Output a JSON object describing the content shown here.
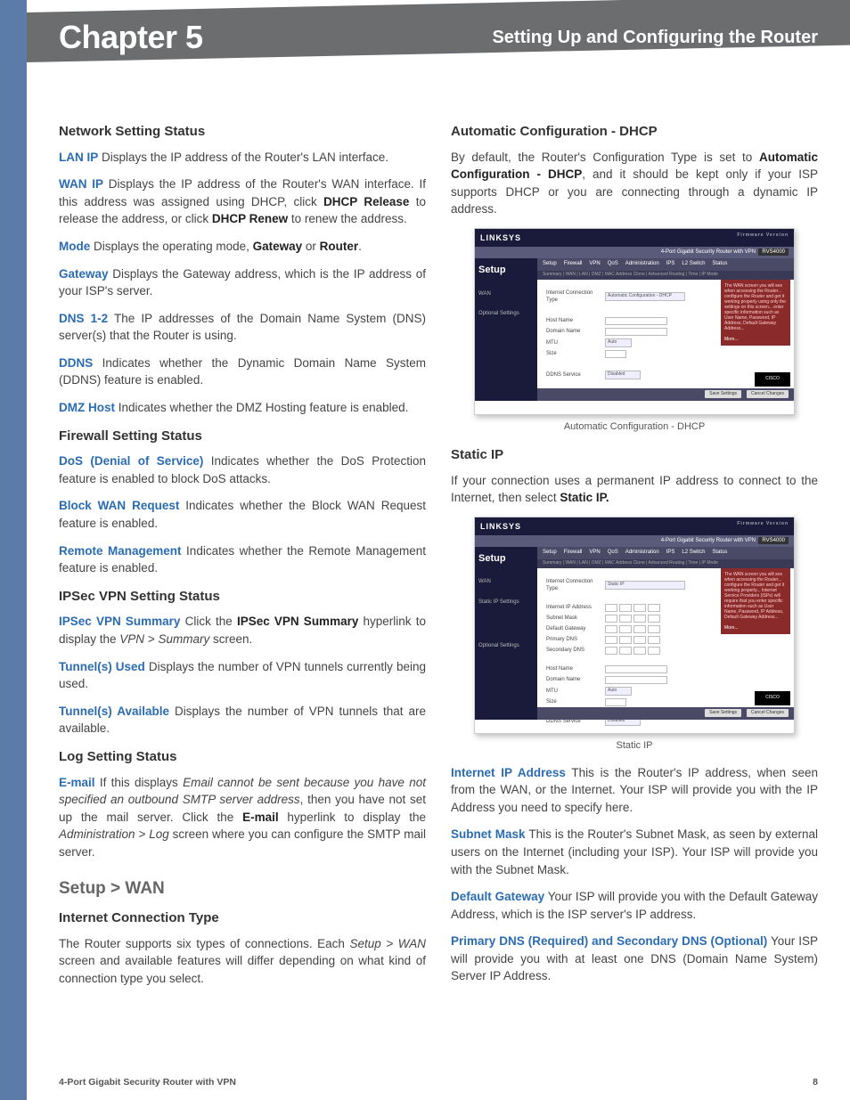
{
  "header": {
    "chapter": "Chapter 5",
    "section": "Setting Up and Configuring the Router"
  },
  "left": {
    "h_network": "Network Setting Status",
    "lan_ip_t": "LAN IP",
    "lan_ip": " Displays the IP address of the Router's LAN interface.",
    "wan_ip_t": "WAN IP",
    "wan_ip_a": " Displays the IP address of the Router's WAN interface. If this address was assigned using DHCP, click ",
    "wan_ip_b1": "DHCP Release",
    "wan_ip_c": " to release the address, or click ",
    "wan_ip_b2": "DHCP  Renew",
    "wan_ip_d": " to renew the address.",
    "mode_t": "Mode",
    "mode_a": "  Displays the operating mode, ",
    "mode_b1": "Gateway",
    "mode_c": " or ",
    "mode_b2": "Router",
    "mode_d": ".",
    "gw_t": "Gateway",
    "gw": "  Displays the Gateway address, which is the IP address of your ISP's server.",
    "dns_t": "DNS 1-2",
    "dns": "  The IP addresses of the Domain Name System (DNS) server(s) that the Router is using.",
    "ddns_t": "DDNS",
    "ddns": " Indicates whether the Dynamic Domain Name System (DDNS) feature is enabled.",
    "dmz_t": "DMZ Host",
    "dmz": "  Indicates whether the DMZ Hosting feature is enabled.",
    "h_firewall": "Firewall Setting Status",
    "dos_t": "DoS (Denial of Service)",
    "dos": " Indicates whether the DoS Protection feature is enabled to block DoS attacks.",
    "bwr_t": "Block WAN Request",
    "bwr": "  Indicates whether the Block WAN Request feature is enabled.",
    "rm_t": "Remote Management",
    "rm": " Indicates whether the Remote Management feature is enabled.",
    "h_ipsec": "IPSec VPN Setting Status",
    "ivs_t": "IPSec VPN Summary",
    "ivs_a": " Click the ",
    "ivs_b": "IPSec VPN Summary",
    "ivs_c": " hyperlink to display the ",
    "ivs_i": "VPN > Summary",
    "ivs_d": " screen.",
    "tu_t": "Tunnel(s) Used",
    "tu": " Displays the number of VPN tunnels currently being used.",
    "ta_t": "Tunnel(s) Available",
    "ta": "  Displays the number of VPN tunnels that are available.",
    "h_log": "Log Setting Status",
    "em_t": "E-mail",
    "em_a": "  If this displays ",
    "em_i": "Email cannot be sent because you have not specified an outbound SMTP server address",
    "em_b": ", then you have not set up the mail server. Click the ",
    "em_bold": "E-mail",
    "em_c": " hyperlink to display the ",
    "em_i2": "Administration > Log",
    "em_d": " screen where you can configure the SMTP mail server.",
    "h_setup": "Setup > WAN",
    "h_ict": "Internet Connection Type",
    "ict_a": "The Router supports six types of connections. Each ",
    "ict_i": "Setup > WAN",
    "ict_b": " screen and available features will differ depending on what kind of connection type you select."
  },
  "right": {
    "h_dhcp": "Automatic Configuration - DHCP",
    "dhcp_a": "By default, the Router's Configuration Type is set to ",
    "dhcp_b": "Automatic Configuration - DHCP",
    "dhcp_c": ", and it should be kept only if your ISP supports DHCP or you are connecting through a dynamic IP address.",
    "cap1": "Automatic Configuration - DHCP",
    "h_static": "Static IP",
    "static_a": "If your connection uses a permanent IP address to connect to the Internet, then select ",
    "static_b": "Static IP.",
    "cap2": "Static IP",
    "iip_t": "Internet IP Address",
    "iip": "  This is the Router's IP address, when seen from the WAN, or the Internet. Your ISP will provide you with the IP Address you need to specify here.",
    "sm_t": "Subnet Mask",
    "sm": "  This is the Router's Subnet Mask, as seen by external users on the Internet (including your ISP). Your ISP will provide you with the Subnet Mask.",
    "dg_t": "Default Gateway",
    "dg": " Your ISP will provide you with the Default Gateway Address, which is the ISP server's IP address.",
    "pdns_t": "Primary DNS (Required) and Secondary DNS (Optional)",
    "pdns": " Your ISP will provide you with at least one DNS (Domain Name System) Server IP Address."
  },
  "fig": {
    "brand": "LINKSYS",
    "model": "4-Port Gigabit Security Router with VPN",
    "` setup": "Setup",
    "setup": "Setup",
    "tabs": [
      "Setup",
      "Firewall",
      "VPN",
      "QoS",
      "Administration",
      "IPS",
      "L2 Switch",
      "Status"
    ],
    "opt": "Optional Settings",
    "statip": "Static IP Settings",
    "ict_label": "Internet Connection Type",
    "dhcp_sel": "Automatic Configuration - DHCP",
    "static_sel": "Static IP",
    "hostname": "Host Name",
    "domain": "Domain Name",
    "mtu": "MTU",
    "mtu_v": "Auto",
    "size": "Size",
    "ddns": "DDNS Service",
    "ddns_v": "Disabled",
    "iip": "Internet IP Address",
    "snm": "Subnet Mask",
    "dgw": "Default Gateway",
    "pdns": "Primary DNS",
    "sdns": "Secondary DNS",
    "save": "Save Settings",
    "cancel": "Cancel Changes",
    "more": "More..."
  },
  "footer": {
    "product": "4-Port Gigabit Security Router with VPN",
    "page": "8"
  }
}
